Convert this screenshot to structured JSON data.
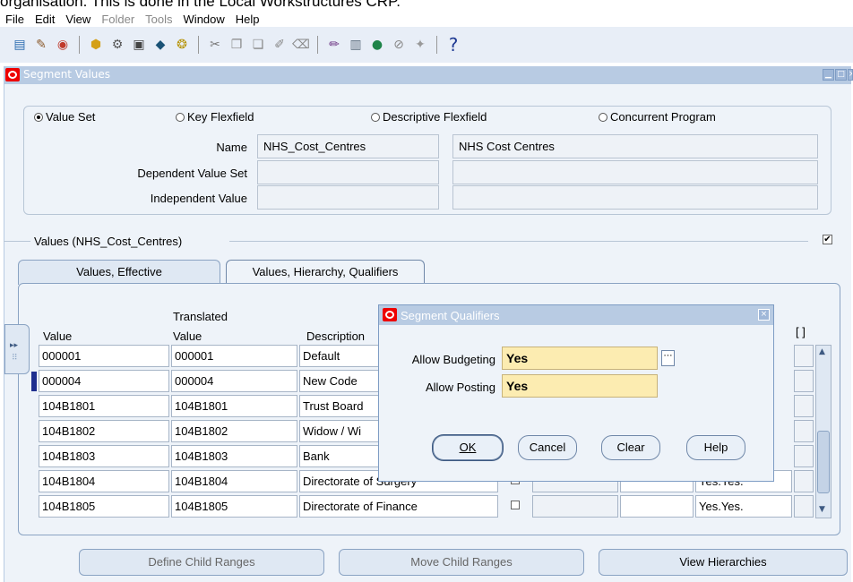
{
  "caption": "organisation. This is done in the Local Workstructures CRP.",
  "menu": [
    "File",
    "Edit",
    "View",
    "Folder",
    "Tools",
    "Window",
    "Help"
  ],
  "window": {
    "title": "Segment Values"
  },
  "radios": [
    "Value Set",
    "Key Flexfield",
    "Descriptive Flexfield",
    "Concurrent Program"
  ],
  "form": {
    "name_label": "Name",
    "name_value": "NHS_Cost_Centres",
    "name_desc": "NHS Cost Centres",
    "dependent_label": "Dependent Value Set",
    "independent_label": "Independent Value"
  },
  "values_section": {
    "title": "Values (NHS_Cost_Centres)"
  },
  "tabs": [
    "Values, Effective",
    "Values, Hierarchy, Qualifiers"
  ],
  "table": {
    "headers": {
      "value": "Value",
      "translated_top": "Translated",
      "translated_bottom": "Value",
      "description": "Description",
      "bracket": "[ ]"
    },
    "rows": [
      {
        "value": "000001",
        "translated": "000001",
        "description": "Default",
        "qual": ""
      },
      {
        "value": "000004",
        "translated": "000004",
        "description": "New Code",
        "qual": ""
      },
      {
        "value": "104B1801",
        "translated": "104B1801",
        "description": "Trust Board",
        "qual": ""
      },
      {
        "value": "104B1802",
        "translated": "104B1802",
        "description": "Widow / Wi",
        "qual": ""
      },
      {
        "value": "104B1803",
        "translated": "104B1803",
        "description": "Bank",
        "qual": ""
      },
      {
        "value": "104B1804",
        "translated": "104B1804",
        "description": "Directorate of Surgery",
        "qual": "Yes.Yes."
      },
      {
        "value": "104B1805",
        "translated": "104B1805",
        "description": "Directorate of Finance",
        "qual": "Yes.Yes."
      }
    ]
  },
  "buttons": [
    "Define Child Ranges",
    "Move Child Ranges",
    "View Hierarchies"
  ],
  "dialog": {
    "title": "Segment Qualifiers",
    "budgeting_label": "Allow Budgeting",
    "budgeting_value": "Yes",
    "posting_label": "Allow Posting",
    "posting_value": "Yes",
    "ok": "OK",
    "cancel": "Cancel",
    "clear": "Clear",
    "help": "Help"
  }
}
